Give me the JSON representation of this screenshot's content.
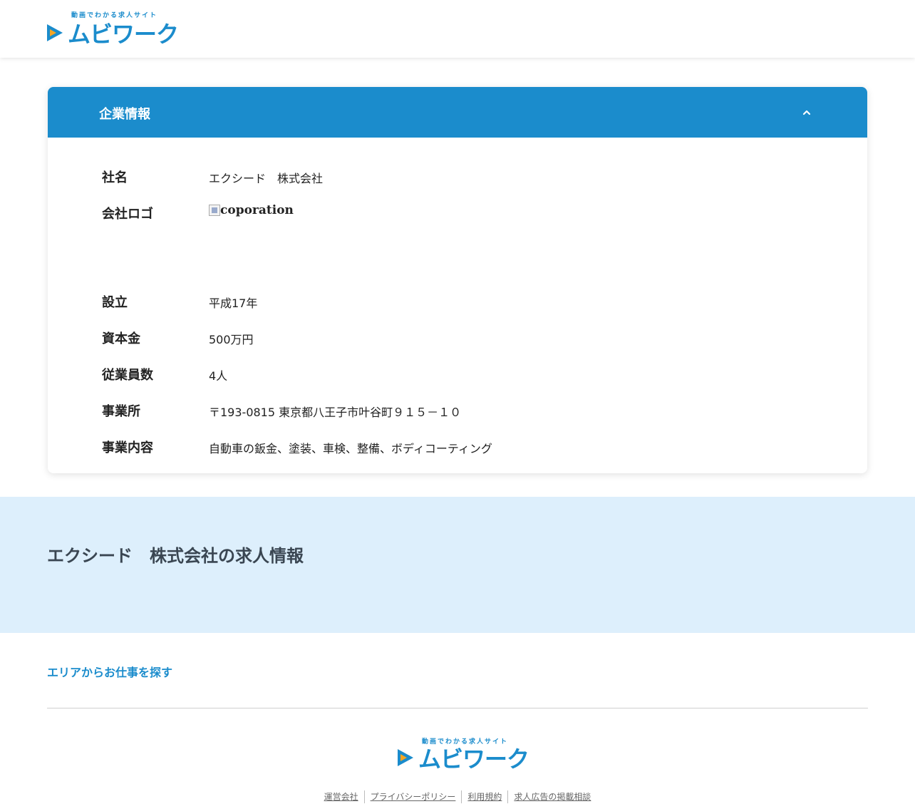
{
  "header": {
    "logo": {
      "tagline": "動画でわかる求人サイト",
      "word": "ムビワーク"
    }
  },
  "company": {
    "section_title": "企業情報",
    "rows": [
      {
        "label": "社名",
        "value": "エクシード　株式会社"
      },
      {
        "label": "会社ロゴ",
        "image_alt": "coporation"
      },
      {
        "label": "設立",
        "value": "平成17年"
      },
      {
        "label": "資本金",
        "value": "500万円"
      },
      {
        "label": "従業員数",
        "value": "4人"
      },
      {
        "label": "事業所",
        "value": "〒193-0815 東京都八王子市叶谷町９１５－１０"
      },
      {
        "label": "事業内容",
        "value": "自動車の鈑金、塗装、車検、整備、ボディコーティング"
      }
    ]
  },
  "jobs": {
    "title": "エクシード　株式会社の求人情報"
  },
  "area_link": "エリアからお仕事を探す",
  "footer": {
    "logo": {
      "tagline": "動画でわかる求人サイト",
      "word": "ムビワーク"
    },
    "links": [
      "運営会社",
      "プライバシーポリシー",
      "利用規約",
      "求人広告の掲載相談"
    ]
  },
  "colors": {
    "brand": "#1b8ccc",
    "accent": "#f5a623",
    "band": "#ddeffc"
  },
  "icons": {
    "collapse": "chevron-up-icon",
    "broken_image": "broken-image-icon",
    "logo_mark": "play-icon"
  }
}
